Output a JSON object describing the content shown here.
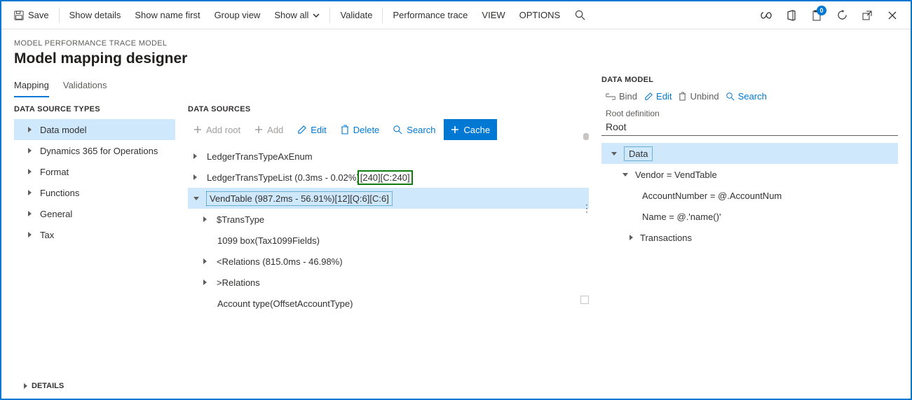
{
  "toolbar": {
    "save": "Save",
    "show_details": "Show details",
    "show_name_first": "Show name first",
    "group_view": "Group view",
    "show_all": "Show all",
    "validate": "Validate",
    "perf_trace": "Performance trace",
    "view": "VIEW",
    "options": "OPTIONS",
    "help_badge": "0"
  },
  "breadcrumb": "MODEL PERFORMANCE TRACE MODEL",
  "title": "Model mapping designer",
  "tabs": {
    "mapping": "Mapping",
    "validations": "Validations"
  },
  "ds_types_header": "DATA SOURCE TYPES",
  "ds_types": [
    "Data model",
    "Dynamics 365 for Operations",
    "Format",
    "Functions",
    "General",
    "Tax"
  ],
  "ds_header": "DATA SOURCES",
  "ds_actions": {
    "add_root": "Add root",
    "add": "Add",
    "edit": "Edit",
    "delete": "Delete",
    "search": "Search",
    "cache": "Cache"
  },
  "ds_tree": {
    "ledger_ax": "LedgerTransTypeAxEnum",
    "ledger_list_a": "LedgerTransTypeList (0.3ms - 0.02%)",
    "ledger_list_b": "[240][C:240]",
    "vendtable": "VendTable (987.2ms - 56.91%)[12][Q:6][C:6]",
    "transtype": "$TransType",
    "box1099": "1099 box(Tax1099Fields)",
    "rel_lt": "<Relations (815.0ms - 46.98%)",
    "rel_gt": ">Relations",
    "account_type": "Account type(OffsetAccountType)"
  },
  "dm_header": "DATA MODEL",
  "dm_actions": {
    "bind": "Bind",
    "edit": "Edit",
    "unbind": "Unbind",
    "search": "Search"
  },
  "dm_root_label": "Root definition",
  "dm_root_value": "Root",
  "dm_tree": {
    "data": "Data",
    "vendor": "Vendor = VendTable",
    "acct": "AccountNumber = @.AccountNum",
    "name": "Name = @.'name()'",
    "tx": "Transactions"
  },
  "details_label": "DETAILS"
}
